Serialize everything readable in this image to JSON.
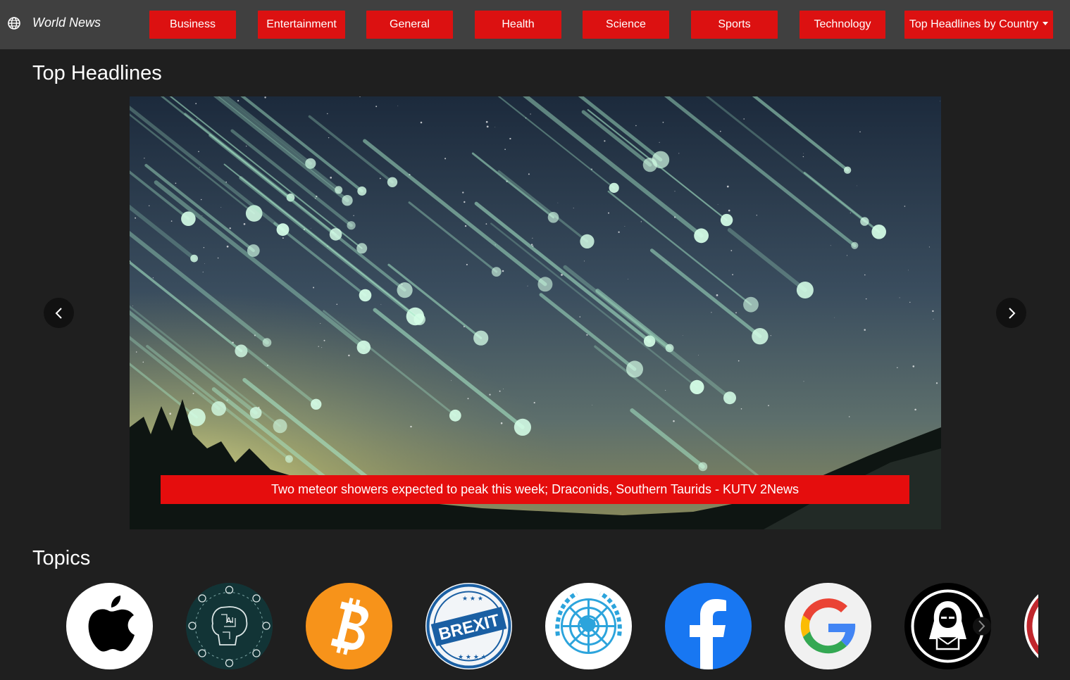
{
  "brand": {
    "name": "World News",
    "icon": "globe-icon"
  },
  "nav": {
    "items": [
      {
        "label": "Business"
      },
      {
        "label": "Entertainment"
      },
      {
        "label": "General"
      },
      {
        "label": "Health"
      },
      {
        "label": "Science"
      },
      {
        "label": "Sports"
      },
      {
        "label": "Technology"
      },
      {
        "label": "Top Headlines by Country",
        "dropdown": true
      }
    ]
  },
  "headlines": {
    "title": "Top Headlines",
    "current_caption": "Two meteor showers expected to peak this week; Draconids, Southern Taurids - KUTV 2News",
    "prev_icon": "chevron-left-icon",
    "next_icon": "chevron-right-icon"
  },
  "topics": {
    "title": "Topics",
    "items": [
      {
        "name": "apple-logo"
      },
      {
        "name": "ai-brain"
      },
      {
        "name": "bitcoin-logo"
      },
      {
        "name": "brexit-stamp",
        "text": "BREXIT"
      },
      {
        "name": "united-nations-emblem"
      },
      {
        "name": "facebook-logo"
      },
      {
        "name": "google-logo"
      },
      {
        "name": "hacker-icon"
      },
      {
        "name": "red-badge-partial"
      }
    ]
  },
  "colors": {
    "navbar_bg": "#404040",
    "page_bg": "#1f1f1f",
    "accent_red": "#dc1111"
  }
}
